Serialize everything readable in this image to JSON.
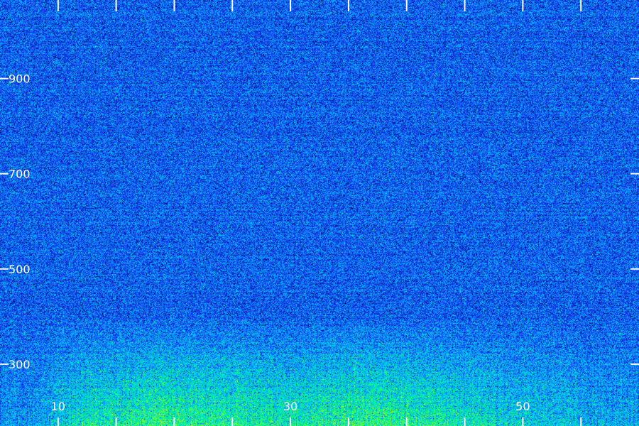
{
  "chart_data": {
    "type": "heatmap",
    "title": "",
    "xlabel": "",
    "ylabel": "",
    "x_range": [
      5,
      60
    ],
    "y_range": [
      170,
      1065
    ],
    "x_major_ticks": [
      10,
      30,
      50
    ],
    "x_major_tick_labels": [
      "10",
      "30",
      "50"
    ],
    "x_minor_ticks": [
      0,
      15,
      20,
      25,
      35,
      40,
      45,
      55
    ],
    "y_ticks": [
      300,
      500,
      700,
      900
    ],
    "y_tick_labels": [
      "300",
      "500",
      "700",
      "900"
    ],
    "grid": false,
    "legend": "none",
    "colormap": [
      "#000014",
      "#00106e",
      "#1a3cff",
      "#00c8ff",
      "#00ff78",
      "#c8ff00"
    ],
    "tick_color": "#ffffff",
    "intensity_profile": [
      {
        "x": 8,
        "low_band_intensity": 0.2
      },
      {
        "x": 12,
        "low_band_intensity": 0.55
      },
      {
        "x": 18,
        "low_band_intensity": 0.75
      },
      {
        "x": 24,
        "low_band_intensity": 0.7
      },
      {
        "x": 30,
        "low_band_intensity": 0.6
      },
      {
        "x": 36,
        "low_band_intensity": 0.75
      },
      {
        "x": 42,
        "low_band_intensity": 0.65
      },
      {
        "x": 48,
        "low_band_intensity": 0.5
      },
      {
        "x": 54,
        "low_band_intensity": 0.35
      },
      {
        "x": 60,
        "low_band_intensity": 0.25
      }
    ]
  }
}
